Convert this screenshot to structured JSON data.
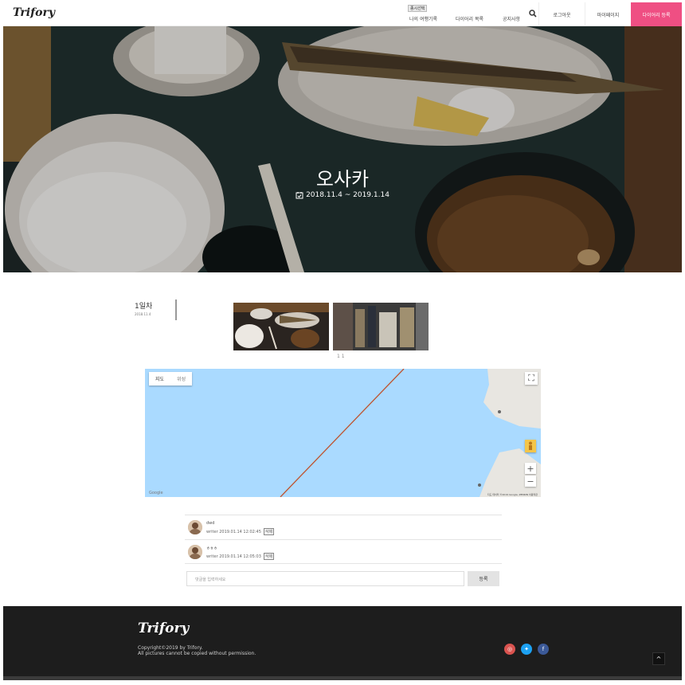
{
  "header": {
    "logo": "Trifory",
    "badge": "종시선택",
    "nav": [
      "나의 여행기록",
      "다이어리 목록",
      "공지사항"
    ],
    "search_icon": "search-icon",
    "login": "로그아웃",
    "mypage": "마이페이지",
    "diary": "다이어리 등록",
    "accent": "#ef4f83"
  },
  "hero": {
    "title": "오사카",
    "dates": "2018.11.4 ~ 2019.1.14",
    "calendar_icon": "calendar-icon"
  },
  "day": {
    "title": "1일차",
    "date": "2018.11.4",
    "pager": "1 1"
  },
  "map": {
    "tabs": [
      "지도",
      "위성"
    ],
    "copyright": "지도 데이터 ©2019 Google, ZENRIN   이용약관",
    "google": "Google"
  },
  "comments": [
    {
      "name": "dwd",
      "writer": "writer 2019.01.14 12:02:45",
      "delete": "삭제"
    },
    {
      "name": "ㅎㅎㅎ",
      "writer": "writer 2019.01.14 12:05:03",
      "delete": "삭제"
    }
  ],
  "comment_form": {
    "placeholder": "댓글을 입력하세요",
    "submit": "등록"
  },
  "footer": {
    "logo": "Trifory",
    "copyright": "Copyright©2019 by Trifory.",
    "notice": "All pictures cannot be copied without permission.",
    "social": [
      {
        "icon": "instagram-icon",
        "glyph": "◎",
        "color": "#d9534f"
      },
      {
        "icon": "twitter-icon",
        "glyph": "✦",
        "color": "#1da1f2"
      },
      {
        "icon": "facebook-icon",
        "glyph": "f",
        "color": "#3b5998"
      }
    ],
    "totop": "^"
  }
}
